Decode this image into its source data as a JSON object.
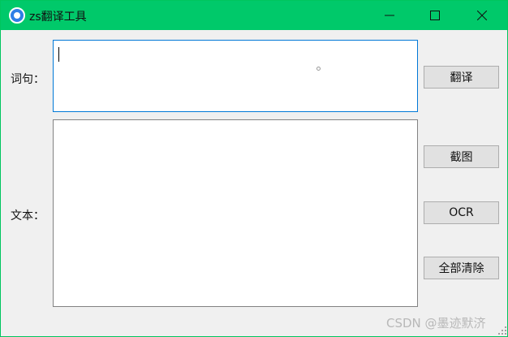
{
  "window": {
    "title": "zs翻译工具",
    "title_bar_color": "#00c96a",
    "icons": {
      "app": "app-icon",
      "minimize": "minimize-icon",
      "maximize": "maximize-icon",
      "close": "close-icon"
    }
  },
  "form": {
    "phrase_label": "词句：",
    "phrase_value": "",
    "text_label": "文本：",
    "text_value": ""
  },
  "buttons": {
    "translate": "翻译",
    "screenshot": "截图",
    "ocr": "OCR",
    "clear_all": "全部清除"
  },
  "watermark": "CSDN @墨迹默济",
  "colors": {
    "focus_border": "#0078d7",
    "button_face": "#e1e1e1"
  }
}
